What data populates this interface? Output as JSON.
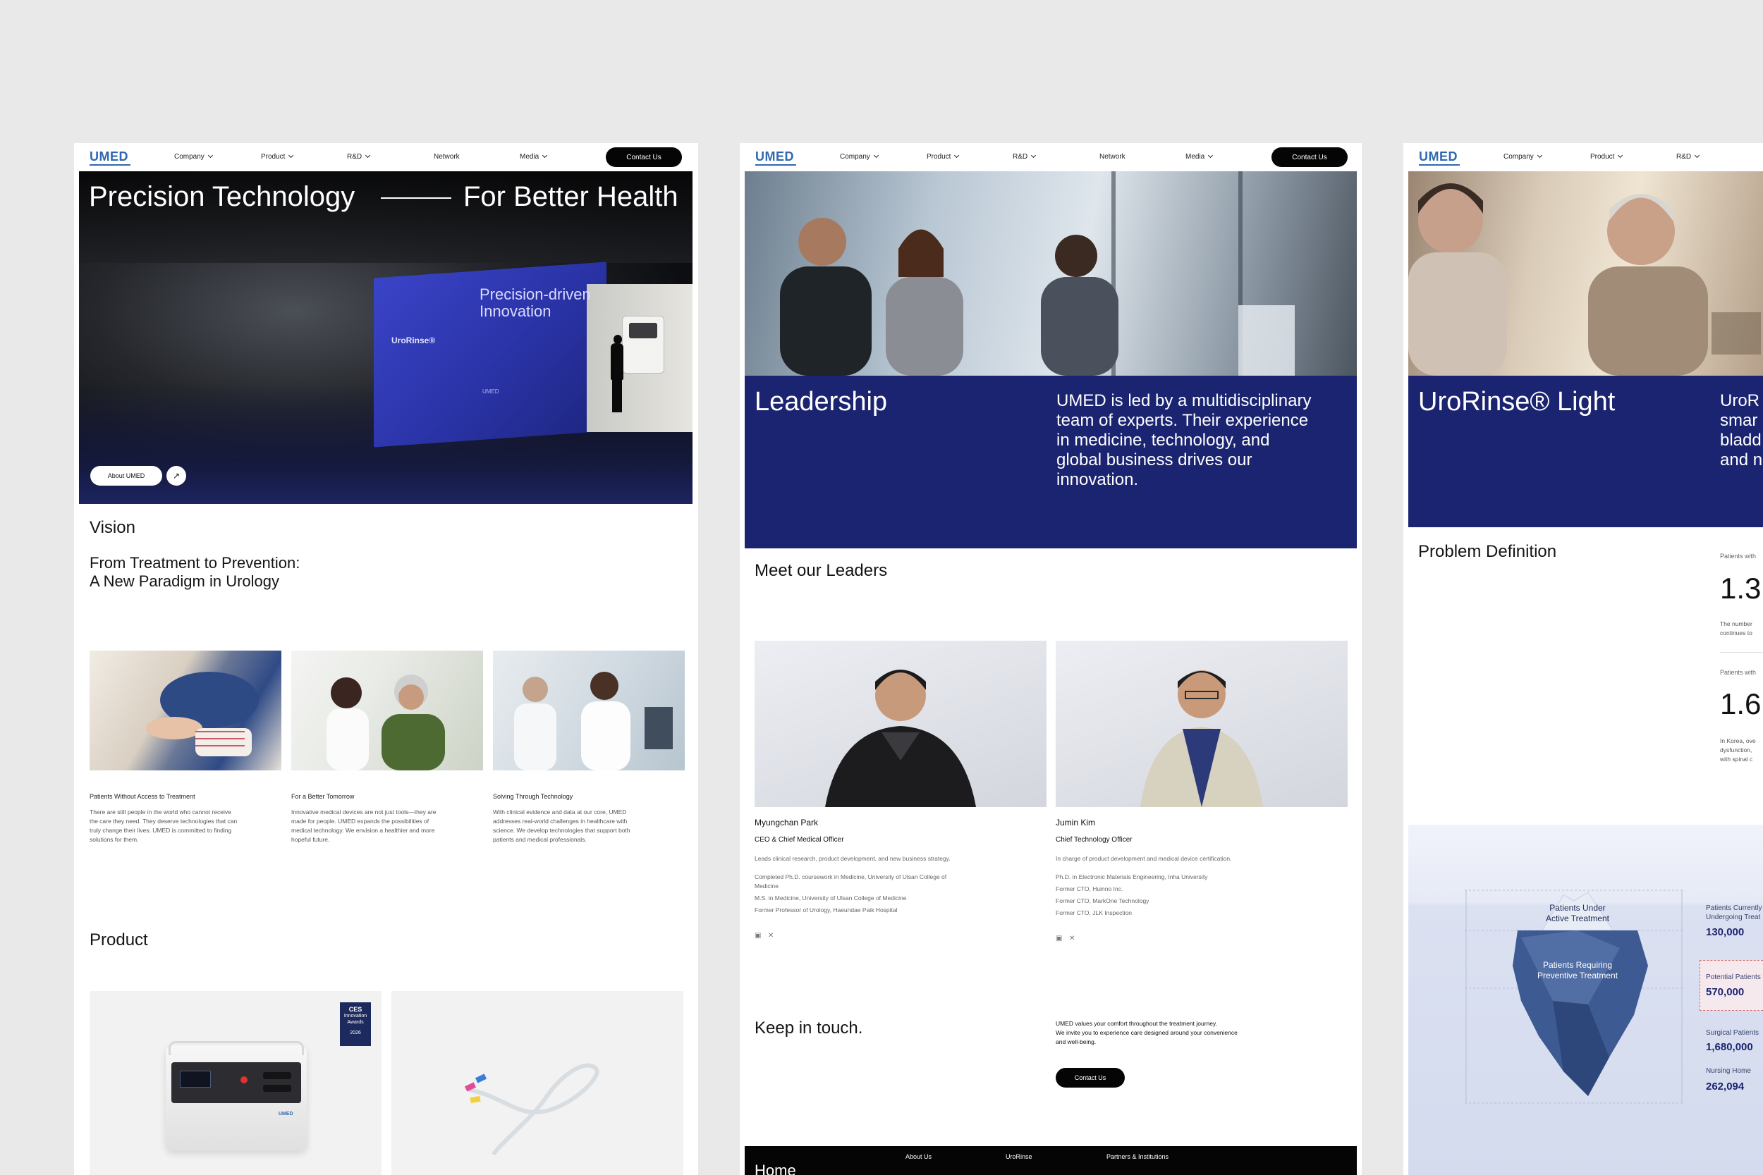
{
  "nav": {
    "logo": "UMED",
    "items": [
      "Company",
      "Product",
      "R&D",
      "Network",
      "Media"
    ],
    "cta": "Contact Us"
  },
  "home": {
    "hero_left": "Precision Technology",
    "hero_right": "For Better Health",
    "booth_text_line1": "Precision-driven",
    "booth_text_line2": "Innovation",
    "booth_brand": "UroRinse®",
    "booth_small": "UMED",
    "about_button": "About UMED",
    "vision_label": "Vision",
    "vision_title_line1": "From Treatment to Prevention:",
    "vision_title_line2": "A New Paradigm in Urology",
    "cards": [
      {
        "title": "Patients Without Access to Treatment",
        "desc_lines": [
          "There are still people in the world who cannot receive",
          "the care they need. They deserve technologies that can",
          "truly change their lives. UMED is committed to finding",
          "solutions for them."
        ]
      },
      {
        "title": "For a Better Tomorrow",
        "desc_lines": [
          "Innovative medical devices are not just tools—they are",
          "made for people. UMED expands the possibilities of",
          "medical technology. We envision a healthier and more",
          "hopeful future."
        ]
      },
      {
        "title": "Solving Through Technology",
        "desc_lines": [
          "With clinical evidence and data at our core, UMED",
          "addresses real-world challenges in healthcare with",
          "science. We develop technologies that support both",
          "patients and medical professionals."
        ]
      }
    ],
    "product_heading": "Product",
    "ces_badge_line1": "CES",
    "ces_badge_line2": "Innovation",
    "ces_badge_line3": "Awards",
    "ces_badge_year": "2026",
    "device_brand": "UMED"
  },
  "leadership": {
    "title": "Leadership",
    "intro_lines": [
      "UMED is led by a multidisciplinary",
      "team of experts. Their experience",
      "in medicine, technology, and",
      "global business drives our",
      "innovation."
    ],
    "meet_heading": "Meet our Leaders",
    "leaders": [
      {
        "name": "Myungchan Park",
        "role": "CEO & Chief Medical Officer",
        "summary": "Leads clinical research, product development, and new business strategy.",
        "details": [
          "Completed Ph.D. coursework in Medicine, University of Ulsan College of",
          "Medicine",
          "M.S. in Medicine, University of Ulsan College of Medicine",
          "Former Professor of Urology, Haeundae Paik Hospital"
        ]
      },
      {
        "name": "Jumin Kim",
        "role": "Chief Technology Officer",
        "summary": "In charge of product development and medical device certification.",
        "details": [
          "Ph.D. in Electronic Materials Engineering, Inha University",
          "Former CTO, Huinno Inc.",
          "Former CTO, MarkOne Technology",
          "Former CTO, JLK Inspection"
        ]
      }
    ],
    "social_icons": [
      "linkedin-icon",
      "x-icon"
    ],
    "keep_heading": "Keep in touch.",
    "keep_text_lines": [
      "UMED values your comfort throughout the treatment journey.",
      " We invite you to experience care designed around your convenience",
      "and well-being."
    ],
    "keep_cta": "Contact Us",
    "footer": {
      "home": "Home",
      "links": [
        "About Us",
        "UroRinse",
        "Partners & Institutions"
      ]
    }
  },
  "product_page": {
    "title": "UroRinse® Light",
    "intro_fragment": [
      "UroR",
      "smar",
      "bladd",
      "and n"
    ],
    "problem_heading": "Problem Definition",
    "stats": [
      {
        "label": "Patients with",
        "number": "1.3I",
        "desc_lines": [
          "The number",
          "continues to"
        ]
      },
      {
        "label": "Patients with",
        "number": "1.6I",
        "desc_lines": [
          "In Korea, ove",
          "dysfunction,",
          "with spinal c"
        ]
      }
    ],
    "iceberg_top": [
      "Patients Under",
      "Active Treatment"
    ],
    "iceberg_mid": [
      "Patients Requiring",
      "Preventive Treatment"
    ],
    "side": [
      {
        "label_lines": [
          "Patients Currently",
          "Undergoing Treat"
        ],
        "value": "130,000"
      },
      {
        "label_lines": [
          "Potential Patients"
        ],
        "value": "570,000"
      },
      {
        "label_lines": [
          "Surgical Patients"
        ],
        "value": "1,680,000"
      },
      {
        "label_lines": [
          "Nursing Home"
        ],
        "value": "262,094"
      }
    ]
  },
  "colors": {
    "brand_blue": "#2f68b0",
    "navy_band": "#1b2470",
    "cta_black": "#050505",
    "background": "#e9e9e9"
  }
}
